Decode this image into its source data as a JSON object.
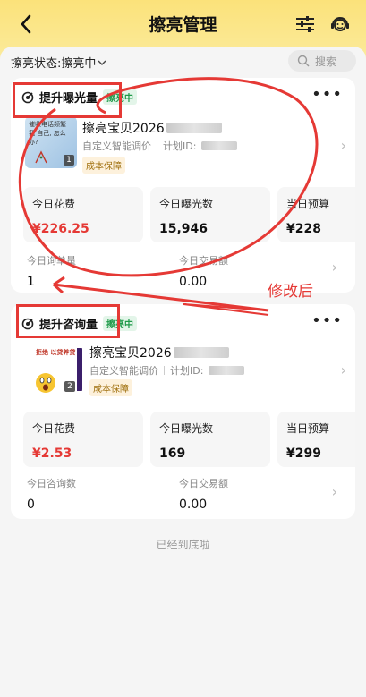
{
  "header": {
    "title": "擦亮管理",
    "back_icon": "chevron-left-icon",
    "filter_icon": "sliders-icon",
    "service_icon": "customer-service-icon"
  },
  "filter": {
    "status_label": "擦亮状态:擦亮中",
    "search_placeholder": "搜索"
  },
  "cards": [
    {
      "goal": "提升曝光量",
      "status": "擦亮中",
      "product_name": "擦亮宝贝2026",
      "strategy": "自定义智能调价",
      "plan_label": "计划ID:",
      "guarantee": "成本保障",
      "thumb_text": "催收电话频繁 我 自己, 怎么办?",
      "thumb_badge": "1",
      "metrics": [
        {
          "label": "今日花费",
          "value": "¥226.25",
          "red": true
        },
        {
          "label": "今日曝光数",
          "value": "15,946",
          "red": false
        },
        {
          "label": "当日预算",
          "value": "¥228",
          "red": false
        }
      ],
      "secondary": [
        {
          "label": "今日询单量",
          "value": "1"
        },
        {
          "label": "今日交易额",
          "value": "0.00"
        }
      ]
    },
    {
      "goal": "提升咨询量",
      "status": "擦亮中",
      "product_name": "擦亮宝贝2026",
      "strategy": "自定义智能调价",
      "plan_label": "计划ID:",
      "guarantee": "成本保障",
      "thumb_text": "拒绝 以贷养贷",
      "thumb_badge": "2",
      "metrics": [
        {
          "label": "今日花费",
          "value": "¥2.53",
          "red": true
        },
        {
          "label": "今日曝光数",
          "value": "169",
          "red": false
        },
        {
          "label": "当日预算",
          "value": "¥299",
          "red": false
        }
      ],
      "secondary": [
        {
          "label": "今日咨询数",
          "value": "0"
        },
        {
          "label": "今日交易额",
          "value": "0.00"
        }
      ]
    }
  ],
  "footer": {
    "end_text": "已经到底啦"
  },
  "annotation": {
    "text": "修改后",
    "color": "#e53935"
  },
  "colors": {
    "accent_yellow": "#fbe27a",
    "red": "#e53935",
    "green": "#1f9a4a"
  }
}
